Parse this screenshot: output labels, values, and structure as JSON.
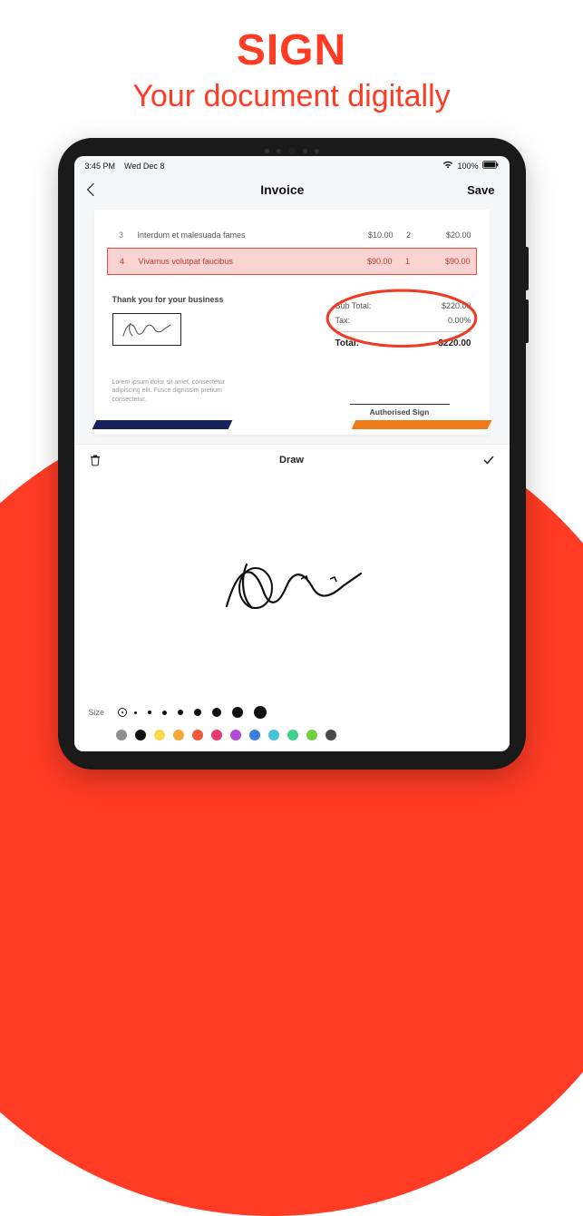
{
  "hero": {
    "title": "SIGN",
    "subtitle": "Your document digitally"
  },
  "statusbar": {
    "time": "3:45 PM",
    "date": "Wed Dec 8",
    "battery_pct": "100%"
  },
  "navbar": {
    "title": "Invoice",
    "save_label": "Save"
  },
  "invoice": {
    "rows": [
      {
        "num": "3",
        "desc": "Interdum et malesuada fames",
        "price": "$10.00",
        "qty": "2",
        "total": "$20.00",
        "highlight": false
      },
      {
        "num": "4",
        "desc": "Vivamus volutpat faucibus",
        "price": "$90.00",
        "qty": "1",
        "total": "$90.00",
        "highlight": true
      }
    ],
    "thanks": "Thank you for your business",
    "totals": {
      "subtotal_label": "Sub Total:",
      "subtotal": "$220.00",
      "tax_label": "Tax:",
      "tax": "0.00%",
      "total_label": "Total:",
      "total": "$220.00"
    },
    "lorem": "Lorem ipsum dolor sit amet, consectetur adipiscing elit. Fusce dignissim pretium consectetur.",
    "auth_sign_label": "Authorised Sign"
  },
  "draw": {
    "title": "Draw",
    "size_label": "Size"
  },
  "sizes": [
    2,
    3,
    4,
    5,
    6,
    8,
    10,
    12,
    14
  ],
  "size_selected_index": 0,
  "colors": [
    "#8e8e8e",
    "#111111",
    "#f6d84a",
    "#f2a83a",
    "#ef5a3c",
    "#e63a6b",
    "#b448d6",
    "#3a7de0",
    "#45c2d6",
    "#3fcf8e",
    "#6ecf3f",
    "#4a4a4a"
  ]
}
